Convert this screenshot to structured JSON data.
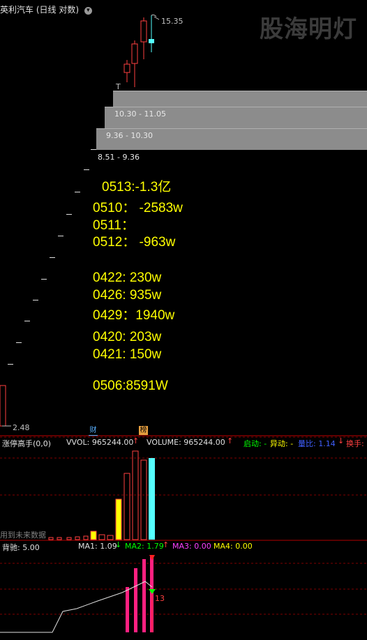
{
  "title": {
    "name": "英利汽车",
    "mode": "(日线 对数)"
  },
  "watermark": "股海明灯",
  "price_labels": {
    "high": "15.35",
    "low": "2.48",
    "tick_mark": "T"
  },
  "bands": [
    {
      "label": ""
    },
    {
      "label": "10.30 - 11.05"
    },
    {
      "label": "9.36 - 10.30"
    },
    {
      "label": "8.51 - 9.36"
    }
  ],
  "annotations": [
    "0513:-1.3亿",
    "0510：  -2583w",
    "0511：",
    "0512：  -963w",
    "0422: 230w",
    "0426: 935w",
    "0429：1940w",
    "0420: 203w",
    "0421: 150w",
    "0506:8591W"
  ],
  "event_badges": {
    "finance": "财",
    "billboard": "榜"
  },
  "volume_panel": {
    "name": "涨停高手(0,0)",
    "vvol": "VVOL: 965244.00",
    "volume": "VOLUME: 965244.00",
    "qidong": "启动: -",
    "yidong": "异动: -",
    "liangbi": "量比: 1.14",
    "huanshou": "换手:",
    "future_note": "用到未来数据",
    "colors": {
      "up": "#ff5050",
      "cyan": "#55ffff",
      "yellow": "#ffff00"
    }
  },
  "indicator_panel": {
    "name": "背驰",
    "value": ": 5.00",
    "ma1": "MA1: 1.09",
    "ma2": "MA2: 1.79",
    "ma3": "MA3: 0.00",
    "ma4": "MA4: 0.00",
    "marker_value": "13",
    "colors": {
      "ma1": "#e0e0e0",
      "ma2": "#00ff00",
      "ma3": "#ff00ff",
      "ma4": "#ffff00"
    }
  }
}
